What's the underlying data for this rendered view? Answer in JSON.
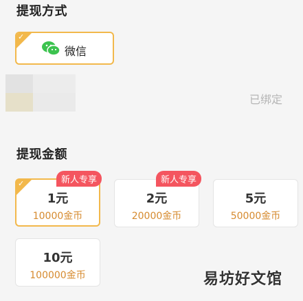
{
  "method_section": {
    "title": "提现方式",
    "method_label": "微信",
    "bound_status": "已绑定"
  },
  "amount_section": {
    "title": "提现金额",
    "options": [
      {
        "value": "1元",
        "coins": "10000金币",
        "badge": "新人专享",
        "selected": true
      },
      {
        "value": "2元",
        "coins": "20000金币",
        "badge": "新人专享",
        "selected": false
      },
      {
        "value": "5元",
        "coins": "50000金币",
        "badge": "",
        "selected": false
      },
      {
        "value": "10元",
        "coins": "100000金币",
        "badge": "",
        "selected": false
      }
    ]
  },
  "watermark": "易坊好文馆",
  "colors": {
    "accent": "#f2b84b",
    "badge": "#f4555f",
    "coin_text": "#d68a2e",
    "wechat_green": "#3cc34f"
  },
  "icons": {
    "method": "wechat-icon",
    "check": "check-icon"
  }
}
